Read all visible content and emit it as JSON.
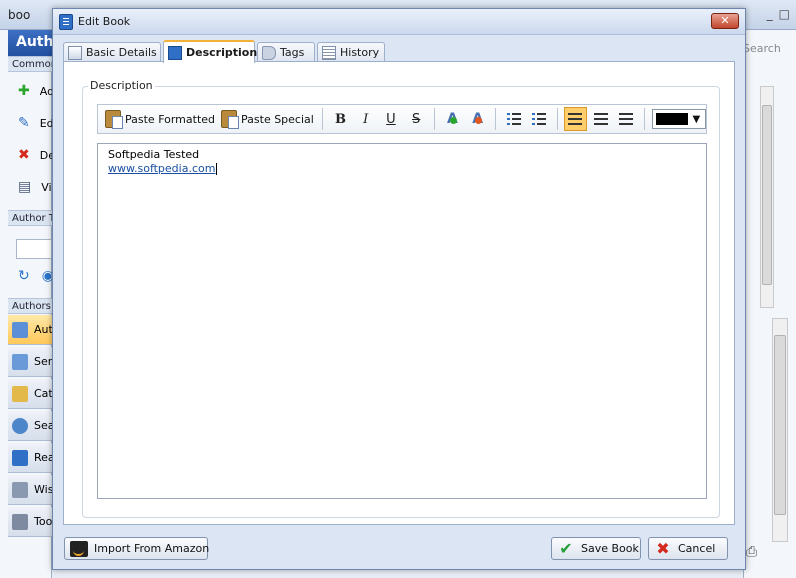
{
  "background": {
    "app_title": "boo",
    "panel_header": "Author",
    "common_section": "Common",
    "actions": [
      {
        "icon": "add-icon",
        "label": "Add"
      },
      {
        "icon": "edit-pencil-icon",
        "label": "Edit"
      },
      {
        "icon": "delete-icon",
        "label": "Delete"
      },
      {
        "icon": "view-icon",
        "label": "View"
      }
    ],
    "author_tools_section": "Author T",
    "authors_section": "Authors",
    "nav": [
      {
        "icon": "authors-icon",
        "label": "Authors"
      },
      {
        "icon": "series-icon",
        "label": "Series"
      },
      {
        "icon": "categories-icon",
        "label": "Categories"
      },
      {
        "icon": "search-icon",
        "label": "Search"
      },
      {
        "icon": "reading-icon",
        "label": "Reading"
      },
      {
        "icon": "wishlist-icon",
        "label": "Wishlist"
      },
      {
        "icon": "tools-icon",
        "label": "Tools"
      }
    ],
    "search_label": "Search",
    "window_controls": [
      "_",
      "□"
    ]
  },
  "dialog": {
    "title": "Edit Book",
    "close_label": "✕",
    "tabs": [
      {
        "label": "Basic Details",
        "icon": "basic-details-icon",
        "active": false
      },
      {
        "label": "Description",
        "icon": "description-icon",
        "active": true
      },
      {
        "label": "Tags",
        "icon": "tag-icon",
        "active": false
      },
      {
        "label": "History",
        "icon": "history-icon",
        "active": false
      }
    ],
    "group_label": "Description",
    "toolbar": {
      "paste_formatted": "Paste Formatted",
      "paste_special": "Paste Special",
      "bold": "B",
      "italic": "I",
      "underline": "U",
      "strike": "S",
      "increase_font": "A",
      "decrease_font": "A",
      "text_color": "#000000"
    },
    "editor": {
      "line1": "Softpedia Tested",
      "link": "www.softpedia.com"
    },
    "buttons": {
      "import": "Import From Amazon",
      "save": "Save Book",
      "cancel": "Cancel"
    }
  }
}
